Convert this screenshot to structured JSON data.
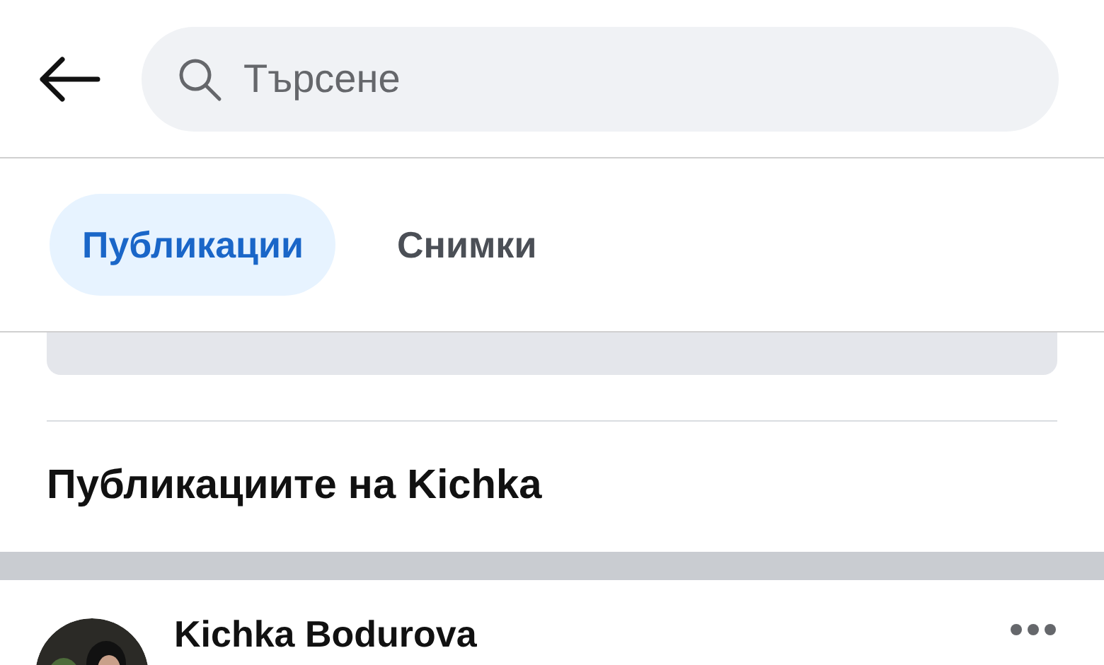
{
  "search": {
    "placeholder": "Търсене"
  },
  "tabs": [
    {
      "label": "Публикации",
      "selected": true
    },
    {
      "label": "Снимки",
      "selected": false
    }
  ],
  "section_title": "Публикациите на Kichka",
  "post": {
    "author": "Kichka Bodurova"
  }
}
